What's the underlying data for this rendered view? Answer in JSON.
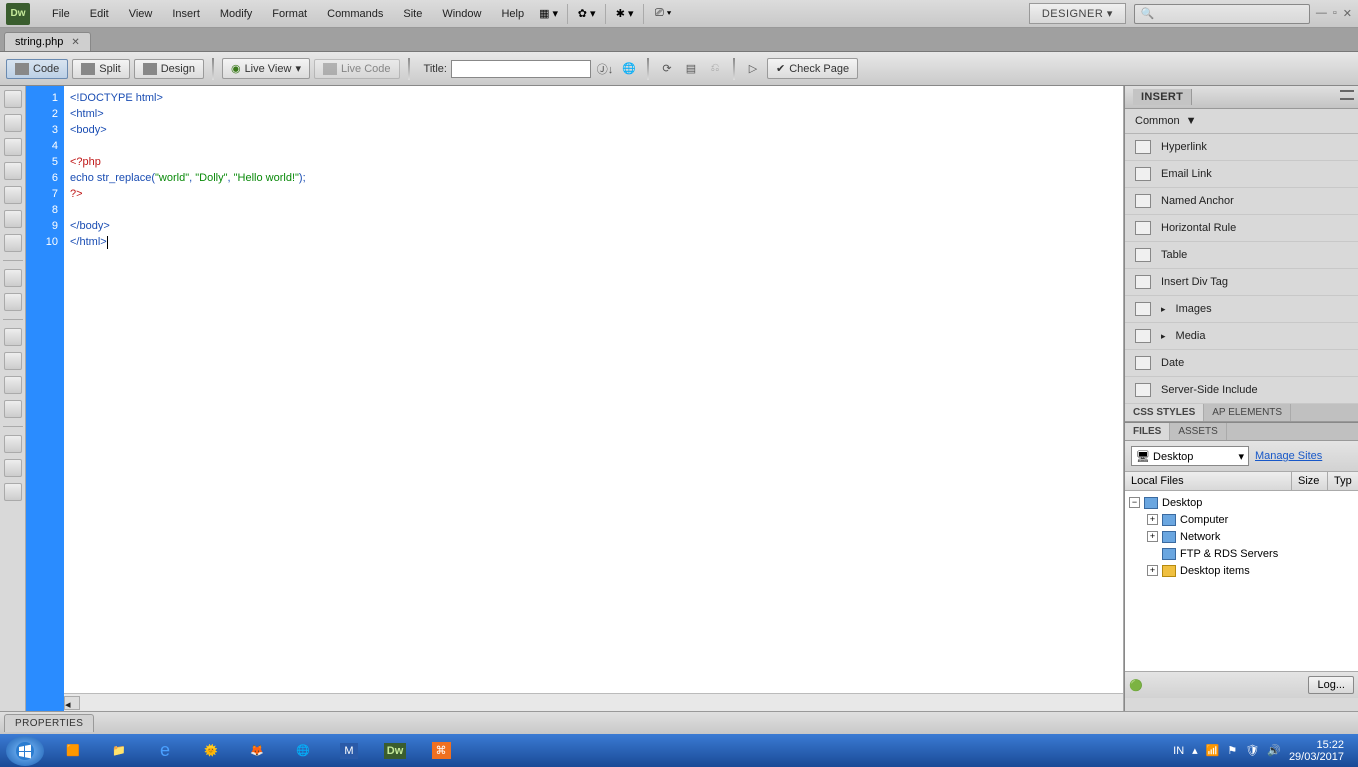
{
  "app": {
    "logo": "Dw",
    "workspace": "DESIGNER ▾"
  },
  "menu": [
    "File",
    "Edit",
    "View",
    "Insert",
    "Modify",
    "Format",
    "Commands",
    "Site",
    "Window",
    "Help"
  ],
  "file_tab": {
    "name": "string.php"
  },
  "toolbar": {
    "code": "Code",
    "split": "Split",
    "design": "Design",
    "live_view": "Live View",
    "live_code": "Live Code",
    "title_label": "Title:",
    "title_value": "",
    "check_page": "Check Page"
  },
  "code_lines": [
    {
      "n": 1,
      "html": "&lt;!DOCTYPE html&gt;",
      "cls": "bl"
    },
    {
      "n": 2,
      "html": "&lt;html&gt;",
      "cls": "bl"
    },
    {
      "n": 3,
      "html": "&lt;body&gt;",
      "cls": "bl"
    },
    {
      "n": 4,
      "html": "",
      "cls": ""
    },
    {
      "n": 5,
      "html": "&lt;?php",
      "cls": "rd"
    },
    {
      "n": 6,
      "html": "echo str_replace(<span class='gr'>\"world\"</span>, <span class='gr'>\"Dolly\"</span>, <span class='gr'>\"Hello world!\"</span>);",
      "cls": "bl"
    },
    {
      "n": 7,
      "html": "?&gt;",
      "cls": "rd"
    },
    {
      "n": 8,
      "html": "",
      "cls": ""
    },
    {
      "n": 9,
      "html": "&lt;/body&gt;",
      "cls": "bl"
    },
    {
      "n": 10,
      "html": "&lt;/html&gt;<span class='caret'></span>",
      "cls": "bl"
    }
  ],
  "insert_panel": {
    "tab": "INSERT",
    "category": "Common",
    "items": [
      "Hyperlink",
      "Email Link",
      "Named Anchor",
      "Horizontal Rule",
      "Table",
      "Insert Div Tag",
      "Images",
      "Media",
      "Date",
      "Server-Side Include"
    ]
  },
  "css_panel": {
    "tab1": "CSS STYLES",
    "tab2": "AP ELEMENTS"
  },
  "files_panel": {
    "tab1": "FILES",
    "tab2": "ASSETS",
    "selected": "Desktop",
    "manage": "Manage Sites",
    "cols": [
      "Local Files",
      "Size",
      "Typ"
    ],
    "root": "Desktop",
    "nodes": [
      "Computer",
      "Network",
      "FTP & RDS Servers",
      "Desktop items"
    ],
    "log": "Log..."
  },
  "props": {
    "tab": "PROPERTIES"
  },
  "tray": {
    "lang": "IN",
    "time": "15:22",
    "date": "29/03/2017"
  }
}
